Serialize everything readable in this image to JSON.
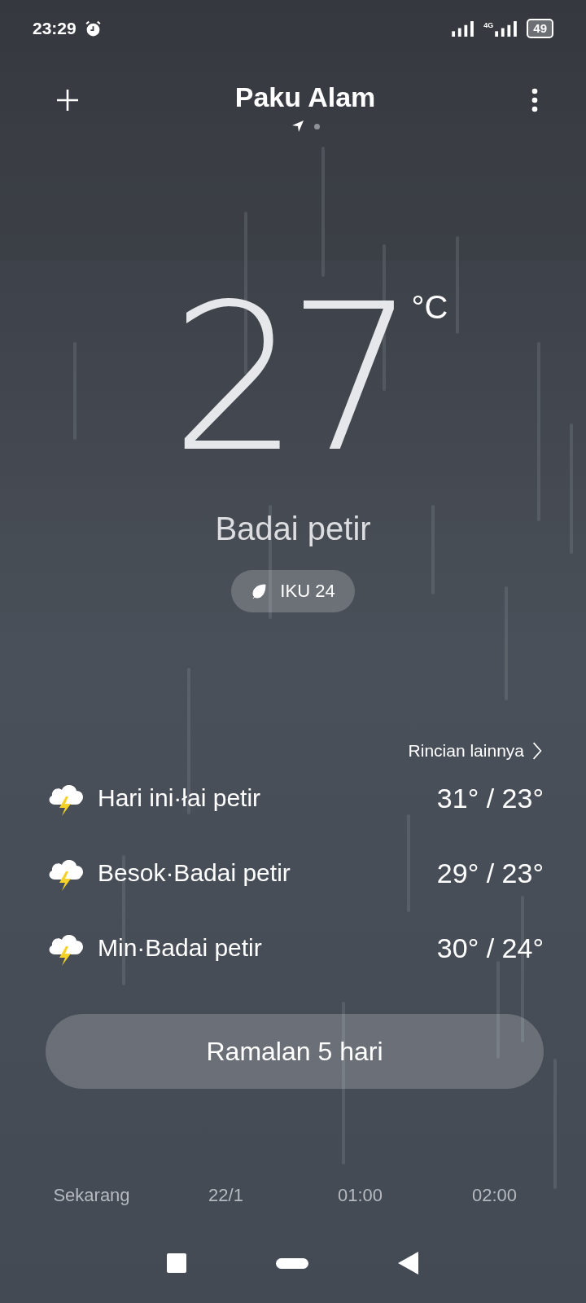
{
  "status_bar": {
    "time": "23:29",
    "network": "4G",
    "battery": "49"
  },
  "header": {
    "title": "Paku Alam",
    "pages": [
      {
        "kind": "location",
        "selected": true
      },
      {
        "kind": "dot",
        "selected": false
      }
    ]
  },
  "current": {
    "temperature": "27",
    "unit": "°C",
    "condition": "Badai petir",
    "aqi": "IKU 24"
  },
  "details_link": "Rincian lainnya",
  "forecast": [
    {
      "label": "Hari ini·łai petir",
      "temps": "31° / 23°"
    },
    {
      "label": "Besok·Badai petir",
      "temps": "29° / 23°"
    },
    {
      "label": "Min·Badai petir",
      "temps": "30° / 24°"
    }
  ],
  "forecast_button": "Ramalan 5 hari",
  "hourly": [
    {
      "time": "Sekarang"
    },
    {
      "time": "22/1"
    },
    {
      "time": "01:00"
    },
    {
      "time": "02:00"
    }
  ]
}
